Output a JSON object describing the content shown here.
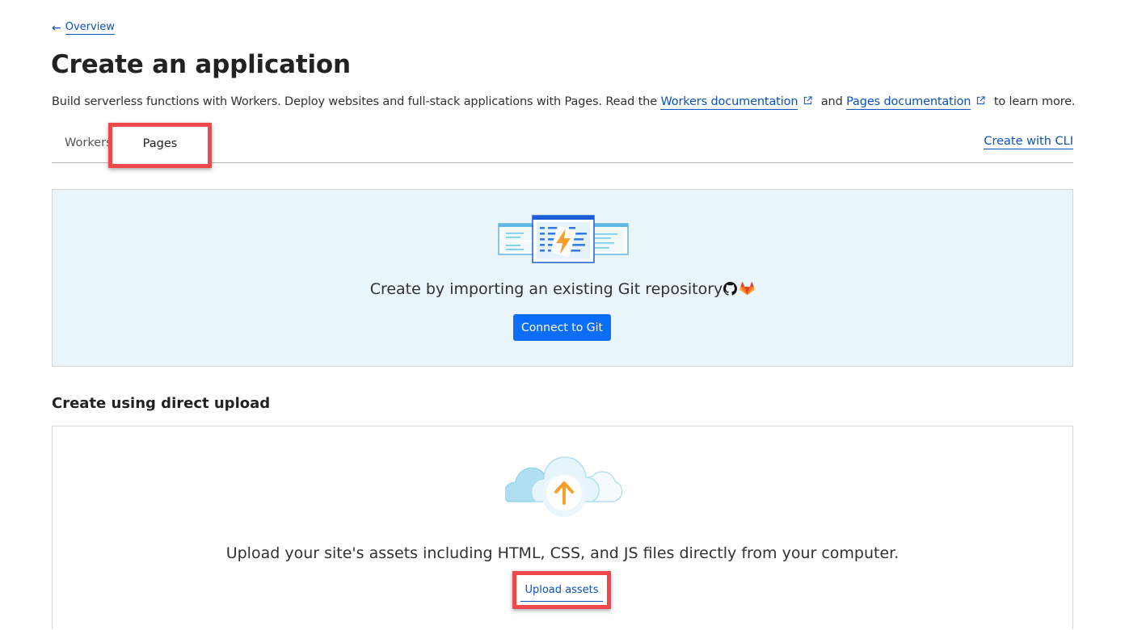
{
  "breadcrumb": {
    "back_label": "Overview",
    "icon": "arrow-left-icon"
  },
  "header": {
    "title": "Create an application",
    "description_prefix": "Build serverless functions with Workers. Deploy websites and full-stack applications with Pages. Read the ",
    "workers_doc_link": "Workers documentation",
    "description_mid": " and ",
    "pages_doc_link": "Pages documentation",
    "description_suffix": " to learn more."
  },
  "tabs": [
    {
      "label": "Workers",
      "active": false
    },
    {
      "label": "Pages",
      "active": true
    }
  ],
  "create_with_cli": "Create with CLI",
  "git_panel": {
    "text": "Create by importing an existing Git repository",
    "icons": [
      "github-icon",
      "gitlab-icon"
    ],
    "button_label": "Connect to Git"
  },
  "direct_upload": {
    "section_title": "Create using direct upload",
    "text": "Upload your site's assets including HTML, CSS, and JS files directly from your computer.",
    "button_label": "Upload assets"
  },
  "colors": {
    "link": "#0A51C1",
    "primary_button": "#0B6EF9",
    "git_panel_bg": "#E9F5FA",
    "highlight": "#F0474D"
  }
}
